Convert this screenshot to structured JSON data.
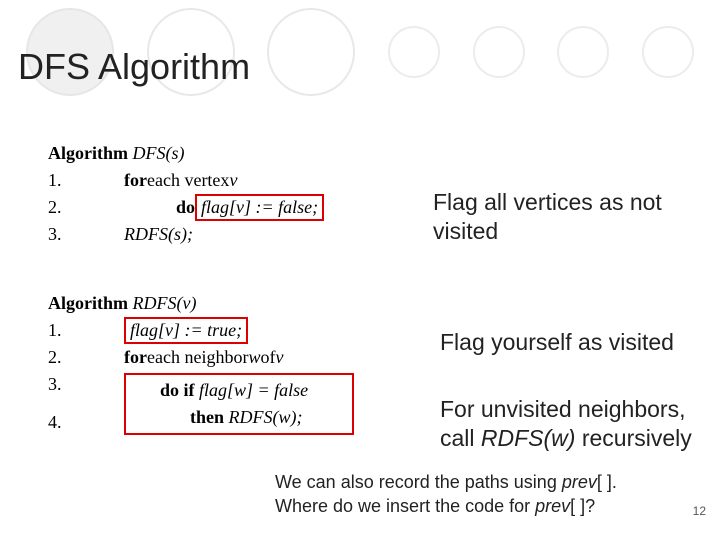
{
  "title": "DFS Algorithm",
  "algo1": {
    "header_pre": "Algorithm ",
    "header_name": "DFS(s)",
    "l1_kw": "for",
    "l1_txt": " each vertex ",
    "l1_var": "v",
    "l2_kw": "do ",
    "l2_body": "flag[v] := false;",
    "l3_body": "RDFS(s);"
  },
  "algo2": {
    "header_pre": "Algorithm ",
    "header_name": "RDFS(v)",
    "l1_body": "flag[v] := true;",
    "l2_kw": "for",
    "l2_txt": " each neighbor ",
    "l2_var": "w",
    "l2_txt2": " of ",
    "l2_var2": "v",
    "l3a": "do if ",
    "l3b": "flag[w] = false",
    "l4a": "then ",
    "l4b": "RDFS(w);"
  },
  "notes": {
    "n1": "Flag all vertices as not visited",
    "n2": "Flag yourself as visited",
    "n3_a": "For unvisited neighbors, call ",
    "n3_b": "RDFS(w)",
    "n3_c": " recursively"
  },
  "footer": {
    "l1_a": "We can also record the paths using ",
    "l1_b": "prev",
    "l1_c": "[ ].",
    "l2_a": "Where do we insert the code for ",
    "l2_b": "prev",
    "l2_c": "[ ]?"
  },
  "page": "12"
}
